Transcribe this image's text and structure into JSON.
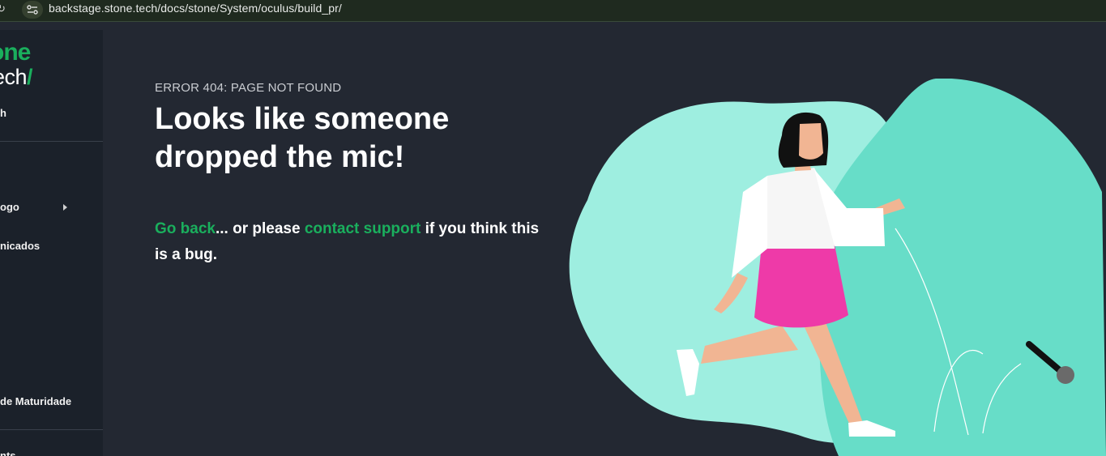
{
  "browser": {
    "url": "backstage.stone.tech/docs/stone/System/oculus/build_pr/"
  },
  "sidebar": {
    "logo_top": "one",
    "logo_bottom": "ech",
    "logo_slash": "/",
    "items": [
      {
        "label": "h"
      },
      {
        "label": "ogo"
      },
      {
        "label": "nicados"
      },
      {
        "label": "de Maturidade"
      },
      {
        "label": "nts"
      }
    ]
  },
  "error": {
    "code": "ERROR 404: PAGE NOT FOUND",
    "headline": "Looks like someone dropped the mic!",
    "go_back": "Go back",
    "middle": "... or please ",
    "contact_support": "contact support",
    "tail": " if you think this is a bug."
  },
  "colors": {
    "accent": "#1aaf5d",
    "background": "#232832",
    "sidebar": "#1b212a",
    "blob_light": "#9eeee0",
    "blob_dark": "#67ddc8",
    "skirt": "#ee3aa8"
  }
}
